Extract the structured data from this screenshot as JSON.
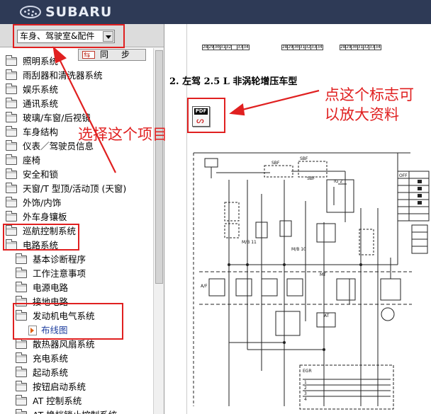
{
  "header": {
    "brand": "SUBARU"
  },
  "left_panel": {
    "category_select": {
      "value": "车身、驾驶室&配件"
    },
    "sync_button": {
      "label": "同步"
    },
    "tree": [
      {
        "label": "照明系统",
        "type": "folder",
        "level": 0
      },
      {
        "label": "雨刮器和清洗器系统",
        "type": "folder",
        "level": 0
      },
      {
        "label": "娱乐系统",
        "type": "folder",
        "level": 0
      },
      {
        "label": "通讯系统",
        "type": "folder",
        "level": 0
      },
      {
        "label": "玻璃/车窗/后视镜",
        "type": "folder",
        "level": 0
      },
      {
        "label": "车身结构",
        "type": "folder",
        "level": 0
      },
      {
        "label": "仪表／驾驶员信息",
        "type": "folder",
        "level": 0
      },
      {
        "label": "座椅",
        "type": "folder",
        "level": 0
      },
      {
        "label": "安全和锁",
        "type": "folder",
        "level": 0
      },
      {
        "label": "天窗/T 型顶/活动顶 (天窗)",
        "type": "folder",
        "level": 0
      },
      {
        "label": "外饰/内饰",
        "type": "folder",
        "level": 0
      },
      {
        "label": "外车身镶板",
        "type": "folder",
        "level": 0
      },
      {
        "label": "巡航控制系统",
        "type": "folder",
        "level": 0
      },
      {
        "label": "电路系统",
        "type": "folder",
        "level": 0
      },
      {
        "label": "基本诊断程序",
        "type": "folder",
        "level": 1
      },
      {
        "label": "工作注意事项",
        "type": "folder",
        "level": 1
      },
      {
        "label": "电源电路",
        "type": "folder",
        "level": 1
      },
      {
        "label": "接地电路",
        "type": "folder",
        "level": 1
      },
      {
        "label": "发动机电气系统",
        "type": "folder",
        "level": 1
      },
      {
        "label": "布线图",
        "type": "doc",
        "level": 2
      },
      {
        "label": "散热器风扇系统",
        "type": "folder",
        "level": 1
      },
      {
        "label": "充电系统",
        "type": "folder",
        "level": 1
      },
      {
        "label": "起动系统",
        "type": "folder",
        "level": 1
      },
      {
        "label": "按钮启动系统",
        "type": "folder",
        "level": 1
      },
      {
        "label": "AT 控制系统",
        "type": "folder",
        "level": 1
      },
      {
        "label": "AT 换档锁止控制系统",
        "type": "folder",
        "level": 1
      }
    ]
  },
  "right_panel": {
    "table_cells": [
      [
        "28",
        "29",
        "30",
        "31",
        "32",
        " ",
        "33",
        "34"
      ],
      [
        "28",
        "29",
        "30",
        "31",
        "32",
        "33",
        "34"
      ],
      [
        "28",
        "29",
        "30",
        "31",
        "32",
        "33",
        "34"
      ]
    ],
    "section_title": "2. 左驾 2.5 L 非涡轮增压车型",
    "pdf_icon_label": "PDF",
    "diagram_labels": {
      "sbf1": "SBF",
      "sbf2": "SBF",
      "sbf3": "SBF",
      "ig2": "IG 2",
      "mb_a": "M/B 11",
      "mb_b": "M/B 10",
      "aif": "A/F",
      "mt": "MT",
      "at": "AT",
      "egr": "EGR",
      "rows": [
        "1",
        "2",
        "3",
        "4"
      ],
      "sw_off": "OFF"
    }
  },
  "annotations": {
    "select_item": "选择这个项目",
    "click_logo_line1": "点这个标志可",
    "click_logo_line2": "以放大资料"
  },
  "colors": {
    "annotation": "#e02020",
    "header_bg": "#2e3a56",
    "tree_leaf": "#1f3f9f"
  }
}
